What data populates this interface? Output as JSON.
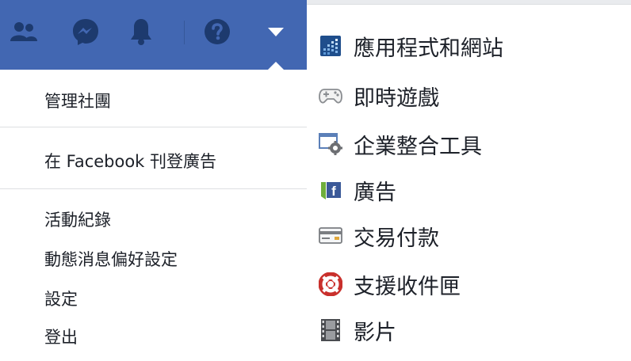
{
  "topbar": {
    "icons": [
      "friends-icon",
      "messenger-icon",
      "notifications-icon",
      "help-icon",
      "menu-dropdown-icon"
    ]
  },
  "left_menu": {
    "items": [
      "管理社團",
      "在 Facebook 刊登廣告",
      "活動紀錄",
      "動態消息偏好設定",
      "設定",
      "登出"
    ]
  },
  "right_menu": {
    "items": [
      {
        "label": "應用程式和網站",
        "icon": "apps-websites-icon"
      },
      {
        "label": "即時遊戲",
        "icon": "gamepad-icon"
      },
      {
        "label": "企業整合工具",
        "icon": "business-integrations-icon"
      },
      {
        "label": "廣告",
        "icon": "facebook-ads-icon"
      },
      {
        "label": "交易付款",
        "icon": "credit-card-icon"
      },
      {
        "label": "支援收件匣",
        "icon": "lifebuoy-icon"
      },
      {
        "label": "影片",
        "icon": "film-icon"
      }
    ]
  },
  "colors": {
    "brand_blue": "#4267b2",
    "text": "#1d2129",
    "divider": "#dddfe2"
  }
}
